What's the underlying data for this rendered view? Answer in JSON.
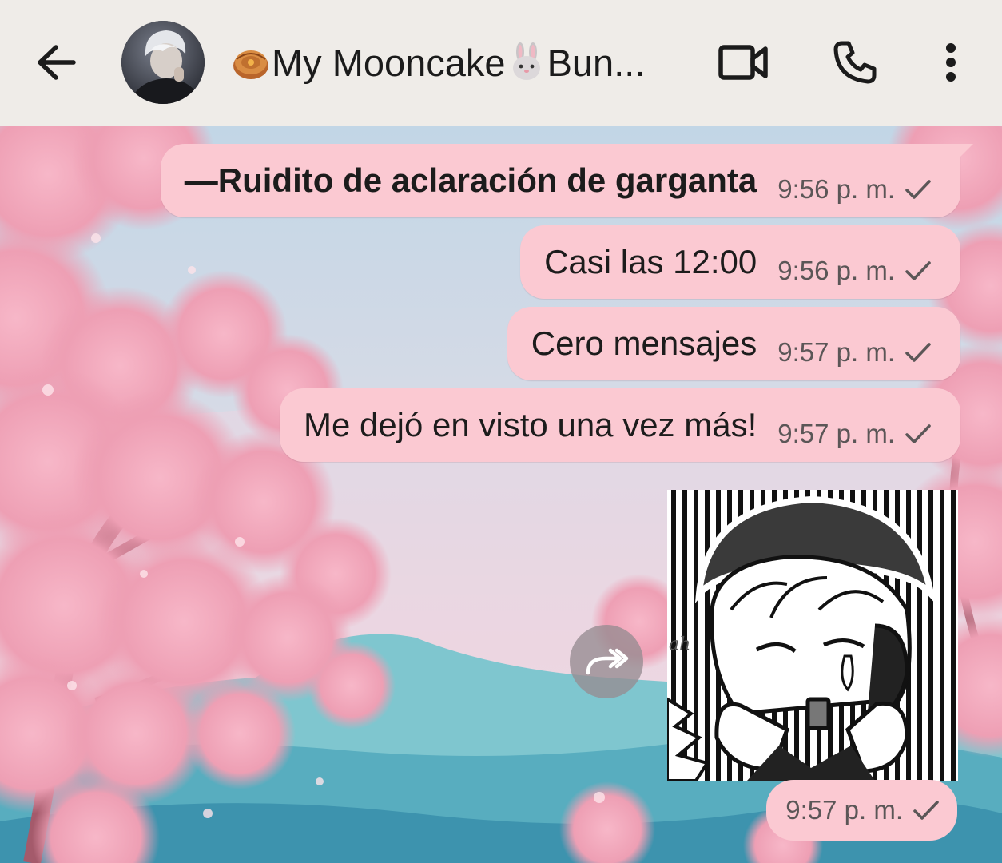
{
  "colors": {
    "header_bg": "#efece8",
    "bubble_bg": "#fbc9d2",
    "text": "#1c1c1c",
    "meta_text": "#5b5657"
  },
  "header": {
    "back_icon": "arrow-left-icon",
    "avatar_icon": "contact-avatar",
    "contact_prefix_emoji": "mooncake-emoji",
    "contact_name_part1": "My Mooncake ",
    "contact_mid_emoji": "rabbit-emoji",
    "contact_name_part2": "Bun...",
    "video_icon": "video-camera-icon",
    "call_icon": "phone-icon",
    "menu_icon": "more-vertical-icon"
  },
  "messages": [
    {
      "text": "—Ruidito de aclaración de garganta",
      "time": "9:56 p. m.",
      "status": "sent-check",
      "bold": true
    },
    {
      "text": "Casi las 12:00",
      "time": "9:56 p. m.",
      "status": "sent-check",
      "bold": false
    },
    {
      "text": "Cero mensajes",
      "time": "9:57 p. m.",
      "status": "sent-check",
      "bold": false
    },
    {
      "text": "Me dejó en visto una vez más!",
      "time": "9:57 p. m.",
      "status": "sent-check",
      "bold": false
    }
  ],
  "sticker": {
    "kind": "anime-crying-sticker",
    "side_text": "ah",
    "time": "9:57 p. m.",
    "status": "sent-check",
    "forward_icon": "forward-icon"
  }
}
